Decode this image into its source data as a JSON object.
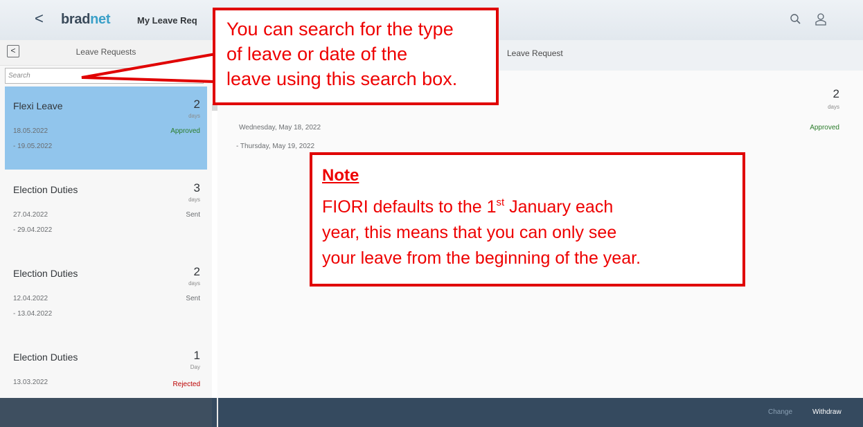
{
  "shell": {
    "back_glyph": "<",
    "logo_prefix": "brad",
    "logo_accent": "net",
    "app_title": "My Leave Req",
    "icons": [
      "search-icon",
      "user-icon"
    ]
  },
  "master": {
    "back_glyph": "<",
    "title": "Leave Requests",
    "search_placeholder": "Search",
    "items": [
      {
        "type": "Flexi Leave",
        "num": "2",
        "unit": "days",
        "start": "18.05.2022",
        "end": "- 19.05.2022",
        "status": "Approved"
      },
      {
        "type": "Election Duties",
        "num": "3",
        "unit": "days",
        "start": "27.04.2022",
        "end": "- 29.04.2022",
        "status": "Sent"
      },
      {
        "type": "Election Duties",
        "num": "2",
        "unit": "days",
        "start": "12.04.2022",
        "end": "- 13.04.2022",
        "status": "Sent"
      },
      {
        "type": "Election Duties",
        "num": "1",
        "unit": "Day",
        "start": "13.03.2022",
        "end": "",
        "status": "Rejected"
      }
    ]
  },
  "detail": {
    "title": "Leave Request",
    "num": "2",
    "unit": "days",
    "start": "Wednesday, May 18, 2022",
    "end": "- Thursday, May 19, 2022",
    "status": "Approved"
  },
  "footer": {
    "change_label": "Change",
    "withdraw_label": "Withdraw"
  },
  "callouts": {
    "search": {
      "line1": "You can search for the type",
      "line2": "of leave or date of the",
      "line3": "leave using this search box."
    },
    "note": {
      "title": "Note",
      "line1_pre": "FIORI defaults to the 1",
      "line1_sup": "st",
      "line1_post": " January each",
      "line2": "year, this means that you can only see",
      "line3": "your leave from the beginning of the year."
    }
  },
  "colors": {
    "selected_item": "#91c5ec",
    "footer": "#354a5f",
    "approved": "#2b7c2b",
    "rejected": "#bb0000",
    "callout": "#e00000"
  }
}
